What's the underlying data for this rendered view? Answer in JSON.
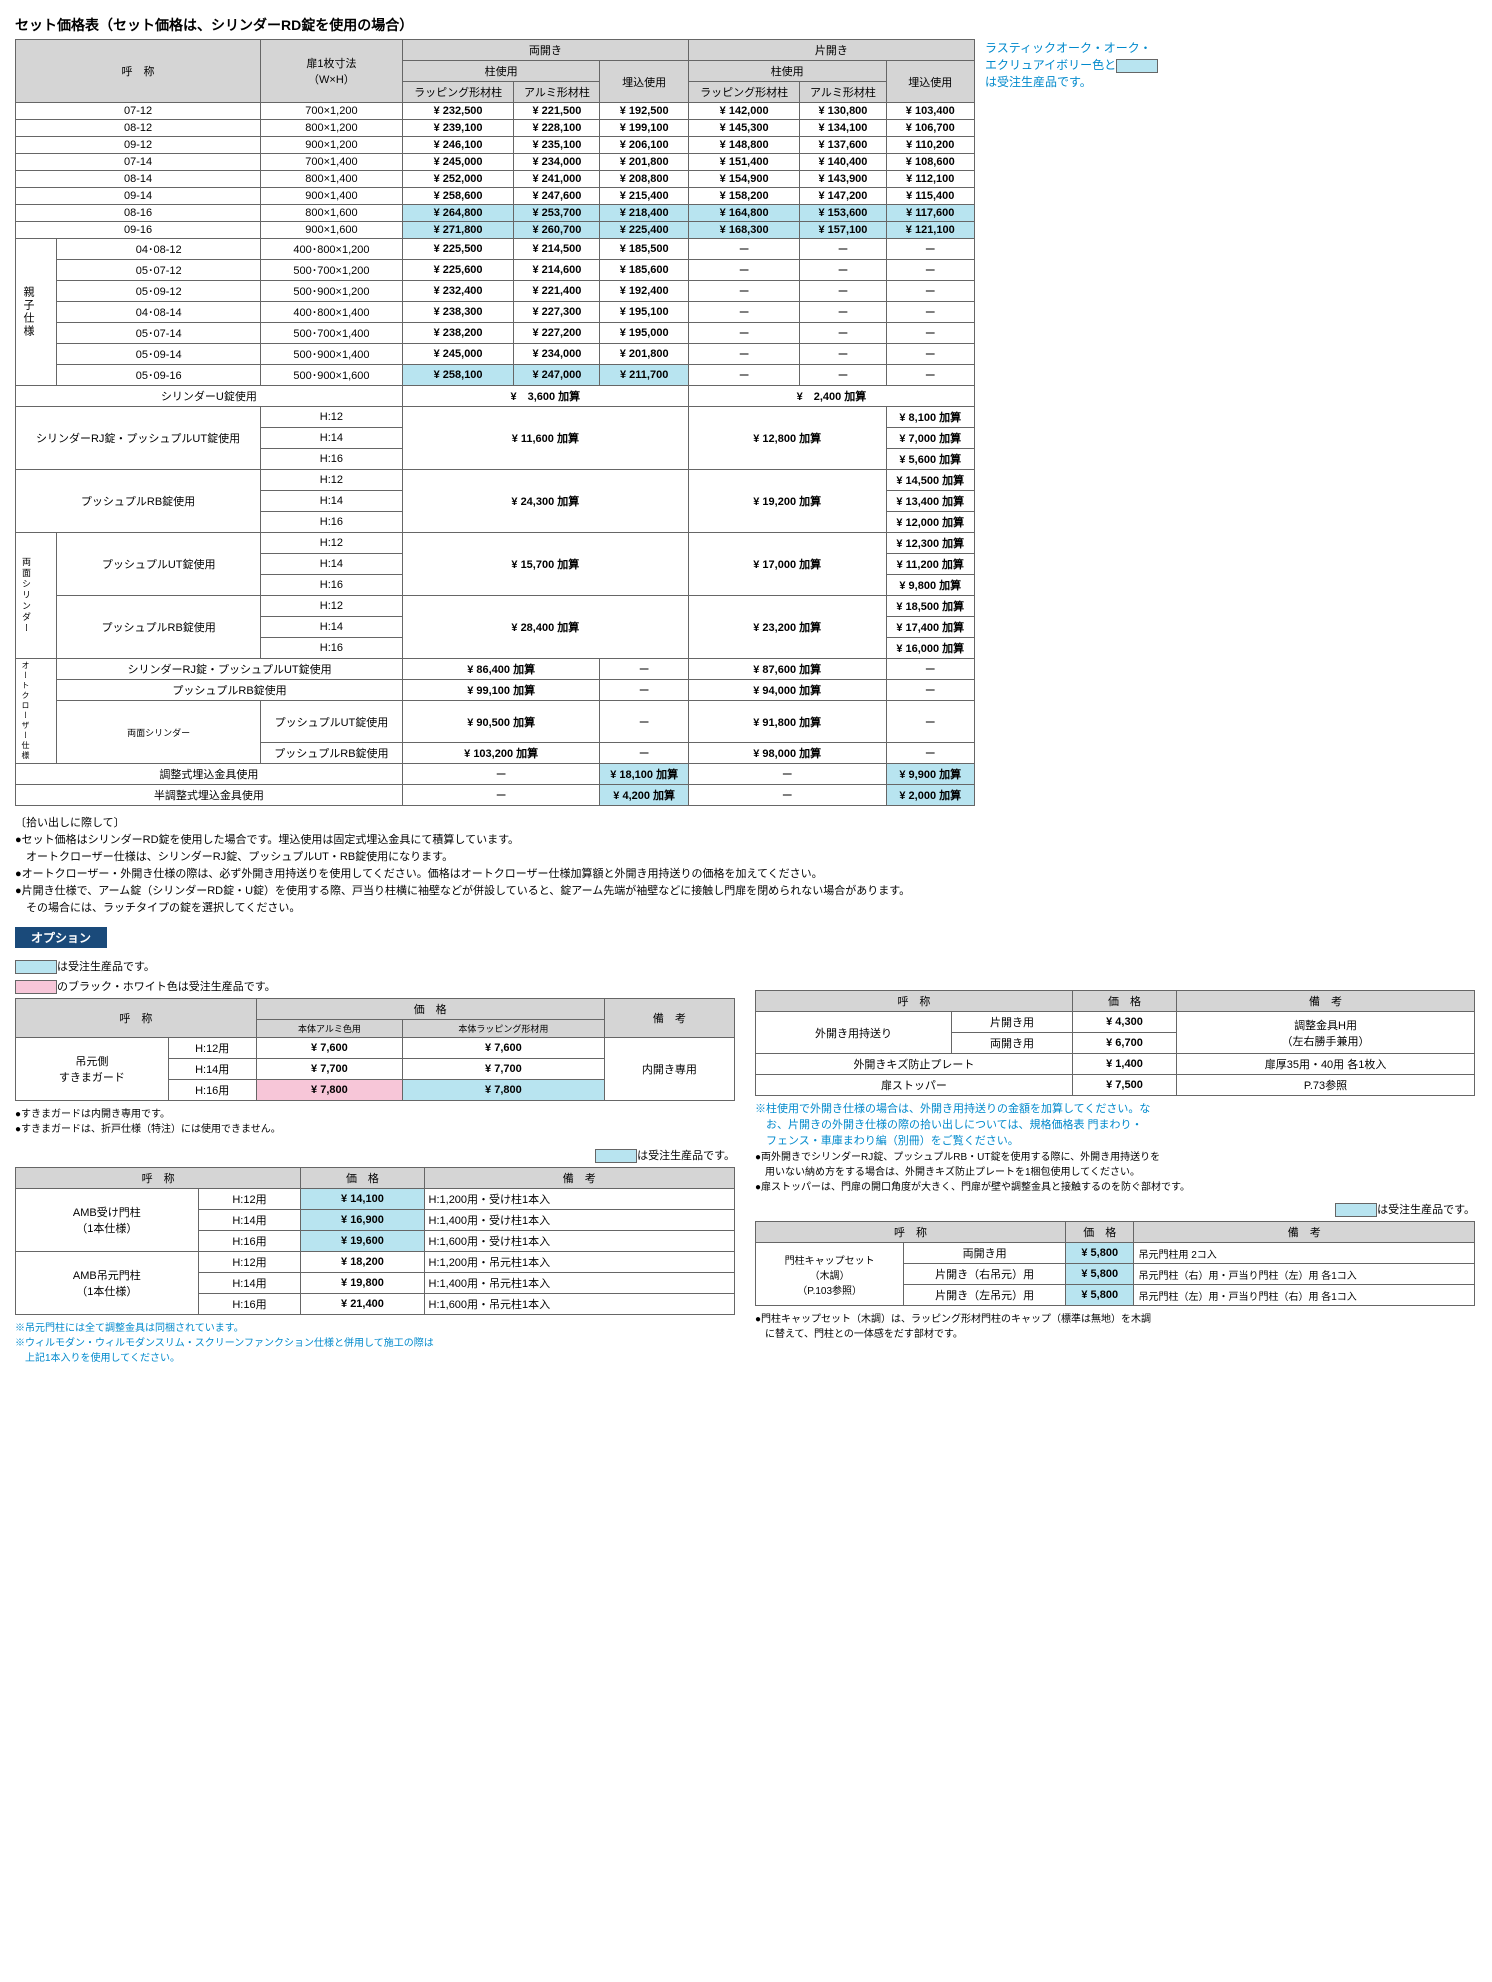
{
  "title": "セット価格表（セット価格は、シリンダーRD錠を使用の場合）",
  "sideNote": {
    "l1": "ラスティックオーク・オーク・",
    "l2": "エクリュアイボリー色と",
    "l3": "は受注生産品です。"
  },
  "hdr": {
    "name": "呼　称",
    "dim": "扉1枚寸法\n（W×H）",
    "both": "両開き",
    "single": "片開き",
    "pillar": "柱使用",
    "embed": "埋込使用",
    "wrap": "ラッピング形材柱",
    "alum": "アルミ形材柱"
  },
  "rows": [
    {
      "n": "07-12",
      "d": "700×1,200",
      "p": [
        "¥ 232,500",
        "¥ 221,500",
        "¥ 192,500",
        "¥ 142,000",
        "¥ 130,800",
        "¥ 103,400"
      ]
    },
    {
      "n": "08-12",
      "d": "800×1,200",
      "p": [
        "¥ 239,100",
        "¥ 228,100",
        "¥ 199,100",
        "¥ 145,300",
        "¥ 134,100",
        "¥ 106,700"
      ]
    },
    {
      "n": "09-12",
      "d": "900×1,200",
      "p": [
        "¥ 246,100",
        "¥ 235,100",
        "¥ 206,100",
        "¥ 148,800",
        "¥ 137,600",
        "¥ 110,200"
      ]
    },
    {
      "n": "07-14",
      "d": "700×1,400",
      "p": [
        "¥ 245,000",
        "¥ 234,000",
        "¥ 201,800",
        "¥ 151,400",
        "¥ 140,400",
        "¥ 108,600"
      ]
    },
    {
      "n": "08-14",
      "d": "800×1,400",
      "p": [
        "¥ 252,000",
        "¥ 241,000",
        "¥ 208,800",
        "¥ 154,900",
        "¥ 143,900",
        "¥ 112,100"
      ]
    },
    {
      "n": "09-14",
      "d": "900×1,400",
      "p": [
        "¥ 258,600",
        "¥ 247,600",
        "¥ 215,400",
        "¥ 158,200",
        "¥ 147,200",
        "¥ 115,400"
      ]
    },
    {
      "n": "08-16",
      "d": "800×1,600",
      "p": [
        "¥ 264,800",
        "¥ 253,700",
        "¥ 218,400",
        "¥ 164,800",
        "¥ 153,600",
        "¥ 117,600"
      ],
      "hl": 1
    },
    {
      "n": "09-16",
      "d": "900×1,600",
      "p": [
        "¥ 271,800",
        "¥ 260,700",
        "¥ 225,400",
        "¥ 168,300",
        "¥ 157,100",
        "¥ 121,100"
      ],
      "hl": 1
    }
  ],
  "oyako": {
    "label": "親子仕様",
    "rows": [
      {
        "n": "04･08-12",
        "d": "400･800×1,200",
        "p": [
          "¥ 225,500",
          "¥ 214,500",
          "¥ 185,500",
          "ー",
          "ー",
          "ー"
        ]
      },
      {
        "n": "05･07-12",
        "d": "500･700×1,200",
        "p": [
          "¥ 225,600",
          "¥ 214,600",
          "¥ 185,600",
          "ー",
          "ー",
          "ー"
        ]
      },
      {
        "n": "05･09-12",
        "d": "500･900×1,200",
        "p": [
          "¥ 232,400",
          "¥ 221,400",
          "¥ 192,400",
          "ー",
          "ー",
          "ー"
        ]
      },
      {
        "n": "04･08-14",
        "d": "400･800×1,400",
        "p": [
          "¥ 238,300",
          "¥ 227,300",
          "¥ 195,100",
          "ー",
          "ー",
          "ー"
        ]
      },
      {
        "n": "05･07-14",
        "d": "500･700×1,400",
        "p": [
          "¥ 238,200",
          "¥ 227,200",
          "¥ 195,000",
          "ー",
          "ー",
          "ー"
        ]
      },
      {
        "n": "05･09-14",
        "d": "500･900×1,400",
        "p": [
          "¥ 245,000",
          "¥ 234,000",
          "¥ 201,800",
          "ー",
          "ー",
          "ー"
        ]
      },
      {
        "n": "05･09-16",
        "d": "500･900×1,600",
        "p": [
          "¥ 258,100",
          "¥ 247,000",
          "¥ 211,700",
          "ー",
          "ー",
          "ー"
        ],
        "hl": 1
      }
    ]
  },
  "cylU": {
    "label": "シリンダーU錠使用",
    "both": "¥　3,600 加算",
    "single": "¥　2,400 加算"
  },
  "cylRJ": {
    "label": "シリンダーRJ錠・プッシュプルUT錠使用",
    "h": [
      "H:12",
      "H:14",
      "H:16"
    ],
    "both": "¥ 11,600 加算",
    "single": "¥ 12,800 加算",
    "embed": [
      "¥  8,100 加算",
      "¥  7,000 加算",
      "¥  5,600 加算"
    ]
  },
  "pushRB": {
    "label": "プッシュプルRB錠使用",
    "h": [
      "H:12",
      "H:14",
      "H:16"
    ],
    "both": "¥ 24,300 加算",
    "single": "¥ 19,200 加算",
    "embed": [
      "¥ 14,500 加算",
      "¥ 13,400 加算",
      "¥ 12,000 加算"
    ]
  },
  "dblCyl": {
    "label": "両面シリンダー",
    "ut": {
      "label": "プッシュプルUT錠使用",
      "h": [
        "H:12",
        "H:14",
        "H:16"
      ],
      "both": "¥ 15,700 加算",
      "single": "¥ 17,000 加算",
      "embed": [
        "¥ 12,300 加算",
        "¥ 11,200 加算",
        "¥  9,800 加算"
      ]
    },
    "rb": {
      "label": "プッシュプルRB錠使用",
      "h": [
        "H:12",
        "H:14",
        "H:16"
      ],
      "both": "¥ 28,400 加算",
      "single": "¥ 23,200 加算",
      "embed": [
        "¥ 18,500 加算",
        "¥ 17,400 加算",
        "¥ 16,000 加算"
      ]
    }
  },
  "auto": {
    "label": "オートクローザー仕様",
    "rows": [
      {
        "n": "シリンダーRJ錠・プッシュプルUT錠使用",
        "both": "¥  86,400 加算",
        "e1": "ー",
        "single": "¥  87,600 加算",
        "e2": "ー"
      },
      {
        "n": "プッシュプルRB錠使用",
        "both": "¥  99,100 加算",
        "e1": "ー",
        "single": "¥  94,000 加算",
        "e2": "ー"
      }
    ],
    "dbl": {
      "label": "両面シリンダー",
      "rows": [
        {
          "n": "プッシュプルUT錠使用",
          "both": "¥  90,500 加算",
          "e1": "ー",
          "single": "¥  91,800 加算",
          "e2": "ー"
        },
        {
          "n": "プッシュプルRB錠使用",
          "both": "¥ 103,200 加算",
          "e1": "ー",
          "single": "¥  98,000 加算",
          "e2": "ー"
        }
      ]
    }
  },
  "adj": {
    "full": {
      "n": "調整式埋込金具使用",
      "p": [
        "ー",
        "¥ 18,100 加算",
        "ー",
        "¥  9,900 加算"
      ]
    },
    "half": {
      "n": "半調整式埋込金具使用",
      "p": [
        "ー",
        "¥  4,200 加算",
        "ー",
        "¥  2,000 加算"
      ]
    }
  },
  "notes": {
    "t": "〔拾い出しに際して〕",
    "items": [
      "●セット価格はシリンダーRD錠を使用した場合です。埋込使用は固定式埋込金具にて積算しています。",
      "　オートクローザー仕様は、シリンダーRJ錠、プッシュプルUT・RB錠使用になります。",
      "●オートクローザー・外開き仕様の際は、必ず外開き用持送りを使用してください。価格はオートクローザー仕様加算額と外開き用持送りの価格を加えてください。",
      "●片開き仕様で、アーム錠（シリンダーRD錠・U錠）を使用する際、戸当り柱横に袖壁などが併設していると、錠アーム先端が袖壁などに接触し門扉を閉められない場合があります。",
      "　その場合には、ラッチタイプの錠を選択してください。"
    ]
  },
  "opt": {
    "hdr": "オプション",
    "legend": {
      "blue": "は受注生産品です。",
      "pink": "のブラック・ホワイト色は受注生産品です。"
    },
    "t1": {
      "h": [
        "呼　称",
        "価　格",
        "備　考"
      ],
      "sh": [
        "本体アルミ色用",
        "本体ラッピング形材用"
      ],
      "name": "吊元側\nすきまガード",
      "rows": [
        {
          "n": "H:12用",
          "p1": "¥ 7,600",
          "p2": "¥ 7,600"
        },
        {
          "n": "H:14用",
          "p1": "¥ 7,700",
          "p2": "¥ 7,700"
        },
        {
          "n": "H:16用",
          "p1": "¥ 7,800",
          "p2": "¥ 7,800",
          "hl": 1
        }
      ],
      "note": "内開き専用",
      "foot": [
        "●すきまガードは内開き専用です。",
        "●すきまガードは、折戸仕様（特注）には使用できません。"
      ]
    },
    "legend2": "は受注生産品です。",
    "t2": {
      "h": [
        "呼　称",
        "価　格",
        "備　考"
      ],
      "g1": {
        "name": "AMB受け門柱\n（1本仕様）",
        "rows": [
          {
            "n": "H:12用",
            "p": "¥ 14,100",
            "note": "H:1,200用・受け柱1本入",
            "hl": 1
          },
          {
            "n": "H:14用",
            "p": "¥ 16,900",
            "note": "H:1,400用・受け柱1本入",
            "hl": 1
          },
          {
            "n": "H:16用",
            "p": "¥ 19,600",
            "note": "H:1,600用・受け柱1本入",
            "hl": 1
          }
        ]
      },
      "g2": {
        "name": "AMB吊元門柱\n（1本仕様）",
        "rows": [
          {
            "n": "H:12用",
            "p": "¥ 18,200",
            "note": "H:1,200用・吊元柱1本入"
          },
          {
            "n": "H:14用",
            "p": "¥ 19,800",
            "note": "H:1,400用・吊元柱1本入"
          },
          {
            "n": "H:16用",
            "p": "¥ 21,400",
            "note": "H:1,600用・吊元柱1本入"
          }
        ]
      },
      "foot": [
        "※吊元門柱には全て調整金具は同梱されています。",
        "※ウィルモダン・ウィルモダンスリム・スクリーンファンクション仕様と併用して施工の際は",
        "　上記1本入りを使用してください。"
      ]
    },
    "t3": {
      "h": [
        "呼　称",
        "価　格",
        "備　考"
      ],
      "rows": [
        {
          "n": "外開き用持送り",
          "sub": "片開き用",
          "p": "¥  4,300",
          "note": "調整金具H用"
        },
        {
          "sub": "両開き用",
          "p": "¥  6,700",
          "note": "（左右勝手兼用）"
        },
        {
          "n": "外開きキズ防止プレート",
          "p": "¥  1,400",
          "note": "扉厚35用・40用 各1枚入"
        },
        {
          "n": "扉ストッパー",
          "p": "¥  7,500",
          "note": "P.73参照"
        }
      ],
      "foot": [
        "※柱使用で外開き仕様の場合は、外開き用持送りの金額を加算してください。な",
        "　お、片開きの外開き仕様の際の拾い出しについては、規格価格表 門まわり・",
        "　フェンス・車庫まわり編（別冊）をご覧ください。",
        "●両外開きでシリンダーRJ錠、プッシュプルRB・UT錠を使用する際に、外開き用持送りを",
        "　用いない納め方をする場合は、外開きキズ防止プレートを1梱包使用してください。",
        "●扉ストッパーは、門扉の開口角度が大きく、門扉が壁や調整金具と接触するのを防ぐ部材です。"
      ]
    },
    "legend3": "は受注生産品です。",
    "t4": {
      "h": [
        "呼　称",
        "価　格",
        "備　考"
      ],
      "name": "門柱キャップセット\n（木調）\n（P.103参照）",
      "rows": [
        {
          "n": "両開き用",
          "p": "¥ 5,800",
          "note": "吊元門柱用 2コ入",
          "hl": 1
        },
        {
          "n": "片開き（右吊元）用",
          "p": "¥ 5,800",
          "note": "吊元門柱（右）用・戸当り門柱（左）用 各1コ入",
          "hl": 1
        },
        {
          "n": "片開き（左吊元）用",
          "p": "¥ 5,800",
          "note": "吊元門柱（左）用・戸当り門柱（右）用 各1コ入",
          "hl": 1
        }
      ],
      "foot": [
        "●門柱キャップセット（木調）は、ラッピング形材門柱のキャップ（標準は無地）を木調",
        "　に替えて、門柱との一体感をだす部材です。"
      ]
    }
  }
}
